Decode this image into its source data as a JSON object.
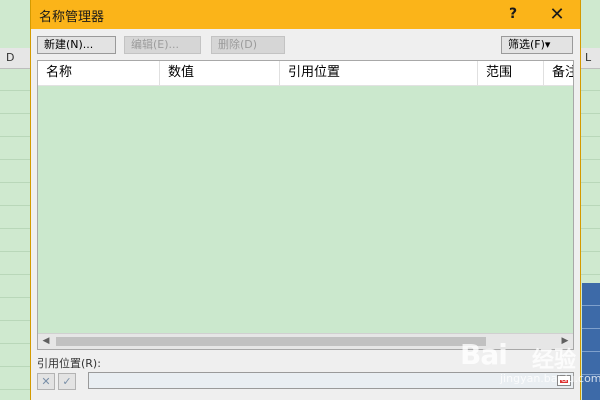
{
  "dialog": {
    "title": "名称管理器",
    "help_label": "?",
    "close_label": "✕"
  },
  "toolbar": {
    "new_label": "新建(N)...",
    "edit_label": "编辑(E)...",
    "delete_label": "删除(D)",
    "filter_label": "筛选(F)▾"
  },
  "table": {
    "columns": [
      {
        "label": "名称"
      },
      {
        "label": "数值"
      },
      {
        "label": "引用位置"
      },
      {
        "label": "范围"
      },
      {
        "label": "备注"
      }
    ],
    "rows": []
  },
  "reference": {
    "label": "引用位置(R):",
    "value": ""
  },
  "spreadsheet": {
    "left_column": "D",
    "right_column": "L"
  },
  "watermark": {
    "brand": "Bai",
    "cn": "经验",
    "url": "jingyan.baidu.com"
  },
  "colors": {
    "title_bar": "#fbb419",
    "list_background": "#cbe8cd"
  }
}
